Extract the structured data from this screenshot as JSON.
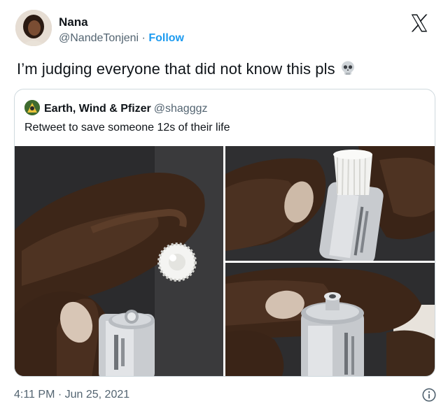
{
  "author": {
    "name": "Nana",
    "handle": "@NandeTonjeni",
    "separator": "·",
    "follow_label": "Follow"
  },
  "tweet": {
    "text": "I’m judging everyone that did not know this pls",
    "emoji_icon": "skull-icon",
    "timestamp": "4:11 PM · Jun 25, 2021"
  },
  "quoted": {
    "name": "Earth, Wind & Pfizer",
    "handle": "@shagggz",
    "text": "Retweet to save someone 12s of their life"
  },
  "media": {
    "photos": [
      {
        "description": "hand-holding-cap-and-tube"
      },
      {
        "description": "cap-on-tube"
      },
      {
        "description": "tube-pierced-opening"
      }
    ]
  },
  "colors": {
    "accent": "#1d9bf0",
    "text": "#0f1419",
    "secondary": "#536471",
    "border": "#cfd9de"
  }
}
